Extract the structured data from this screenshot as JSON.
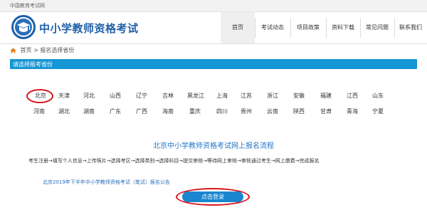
{
  "topbar": {
    "text": "中国教育考试网"
  },
  "header": {
    "site_title": "中小学教师资格考试",
    "nav": [
      {
        "label": "首页",
        "active": true
      },
      {
        "label": "考试动态"
      },
      {
        "label": "项目政策"
      },
      {
        "label": "资料下载"
      },
      {
        "label": "常见问题"
      },
      {
        "label": "联系我们"
      }
    ]
  },
  "breadcrumb": {
    "home": "首页",
    "separator": ">",
    "current": "报名选择省份"
  },
  "section": {
    "title": "请选择报考省份"
  },
  "provinces": {
    "row1": [
      "北京",
      "天津",
      "河北",
      "山西",
      "辽宁",
      "吉林",
      "黑龙江",
      "上海",
      "江苏",
      "浙江",
      "安徽",
      "福建",
      "江西",
      "山东"
    ],
    "row2": [
      "河南",
      "湖北",
      "湖南",
      "广东",
      "广西",
      "海南",
      "重庆",
      "四川",
      "贵州",
      "云南",
      "陕西",
      "甘肃",
      "青海",
      "宁夏"
    ],
    "selected": "北京"
  },
  "flow": {
    "title": "北京中小学教师资格考试网上报名流程",
    "steps": "考生注册→填写个人信息→上传照片→选择考区→选择类别→选择科目→提交审核→等待网上审核→审核通过考生→网上缴费→完成报名",
    "notice": "北京2019年下半年中小学教师资格考试（笔试）报名公告",
    "login_button": "点击登录"
  },
  "colors": {
    "brand_blue": "#1f5fa8",
    "bar_blue": "#1596d4",
    "button_blue": "#1a86d0",
    "highlight_red": "#d6161b"
  },
  "icons": {
    "logo": "teacher-cert-logo",
    "home": "home-icon"
  }
}
